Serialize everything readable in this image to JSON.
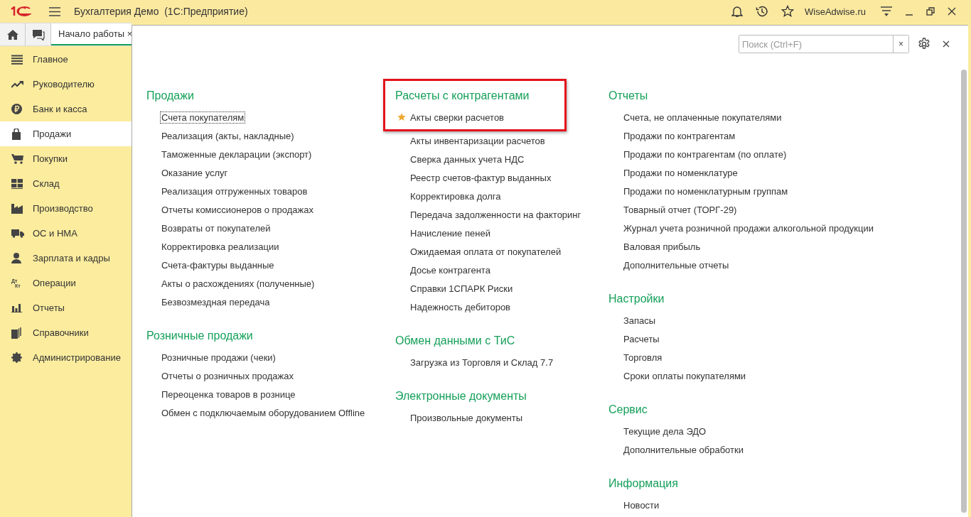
{
  "app": {
    "title": "Бухгалтерия Демо  (1С:Предприятие)",
    "user": "WiseAdwise.ru"
  },
  "tabs": [
    {
      "label": "Начало работы",
      "close": "×",
      "selected": true
    }
  ],
  "sidebar": {
    "items": [
      {
        "label": "Главное",
        "kind": "list",
        "selected": false
      },
      {
        "label": "Руководителю",
        "kind": "trend",
        "selected": false
      },
      {
        "label": "Банк и касса",
        "kind": "ruble",
        "selected": false
      },
      {
        "label": "Продажи",
        "kind": "bag",
        "selected": true
      },
      {
        "label": "Покупки",
        "kind": "cart",
        "selected": false
      },
      {
        "label": "Склад",
        "kind": "grid",
        "selected": false
      },
      {
        "label": "Производство",
        "kind": "factory",
        "selected": false
      },
      {
        "label": "ОС и НМА",
        "kind": "truck",
        "selected": false
      },
      {
        "label": "Зарплата и кадры",
        "kind": "person",
        "selected": false
      },
      {
        "label": "Операции",
        "kind": "dtkt",
        "selected": false
      },
      {
        "label": "Отчеты",
        "kind": "bars",
        "selected": false
      },
      {
        "label": "Справочники",
        "kind": "books",
        "selected": false
      },
      {
        "label": "Администрирование",
        "kind": "gear",
        "selected": false
      }
    ]
  },
  "dtkt_icon": {
    "top": "Дт",
    "bottom": "Кт"
  },
  "search": {
    "placeholder": "Поиск (Ctrl+F)",
    "clear": "×"
  },
  "columns": [
    [
      {
        "title": "Продажи",
        "highlighted": false,
        "items": [
          {
            "label": "Счета покупателям",
            "favorite": false,
            "focused": true
          },
          {
            "label": "Реализация (акты, накладные)",
            "favorite": false,
            "focused": false
          },
          {
            "label": "Таможенные декларации (экспорт)",
            "favorite": false,
            "focused": false
          },
          {
            "label": "Оказание услуг",
            "favorite": false,
            "focused": false
          },
          {
            "label": "Реализация отгруженных товаров",
            "favorite": false,
            "focused": false
          },
          {
            "label": "Отчеты комиссионеров о продажах",
            "favorite": false,
            "focused": false
          },
          {
            "label": "Возвраты от покупателей",
            "favorite": false,
            "focused": false
          },
          {
            "label": "Корректировка реализации",
            "favorite": false,
            "focused": false
          },
          {
            "label": "Счета-фактуры выданные",
            "favorite": false,
            "focused": false
          },
          {
            "label": "Акты о расхождениях (полученные)",
            "favorite": false,
            "focused": false
          },
          {
            "label": "Безвозмездная передача",
            "favorite": false,
            "focused": false
          }
        ]
      },
      {
        "title": "Розничные продажи",
        "highlighted": false,
        "items": [
          {
            "label": "Розничные продажи (чеки)",
            "favorite": false,
            "focused": false
          },
          {
            "label": "Отчеты о розничных продажах",
            "favorite": false,
            "focused": false
          },
          {
            "label": "Переоценка товаров в рознице",
            "favorite": false,
            "focused": false
          },
          {
            "label": "Обмен с подключаемым оборудованием Offline",
            "favorite": false,
            "focused": false
          }
        ]
      }
    ],
    [
      {
        "title": "Расчеты с контрагентами",
        "highlighted": true,
        "items": [
          {
            "label": "Акты сверки расчетов",
            "favorite": true,
            "focused": false
          },
          {
            "label": "Акты инвентаризации расчетов",
            "favorite": false,
            "focused": false
          },
          {
            "label": "Сверка данных учета НДС",
            "favorite": false,
            "focused": false
          },
          {
            "label": "Реестр счетов-фактур выданных",
            "favorite": false,
            "focused": false
          },
          {
            "label": "Корректировка долга",
            "favorite": false,
            "focused": false
          },
          {
            "label": "Передача задолженности на факторинг",
            "favorite": false,
            "focused": false
          },
          {
            "label": "Начисление пеней",
            "favorite": false,
            "focused": false
          },
          {
            "label": "Ожидаемая оплата от покупателей",
            "favorite": false,
            "focused": false
          },
          {
            "label": "Досье контрагента",
            "favorite": false,
            "focused": false
          },
          {
            "label": "Справки 1СПАРК Риски",
            "favorite": false,
            "focused": false
          },
          {
            "label": "Надежность дебиторов",
            "favorite": false,
            "focused": false
          }
        ]
      },
      {
        "title": "Обмен данными с ТиС",
        "highlighted": false,
        "items": [
          {
            "label": "Загрузка из Торговля и Склад 7.7",
            "favorite": false,
            "focused": false
          }
        ]
      },
      {
        "title": "Электронные документы",
        "highlighted": false,
        "items": [
          {
            "label": "Произвольные документы",
            "favorite": false,
            "focused": false
          }
        ]
      }
    ],
    [
      {
        "title": "Отчеты",
        "highlighted": false,
        "items": [
          {
            "label": "Счета, не оплаченные покупателями",
            "favorite": false,
            "focused": false
          },
          {
            "label": "Продажи по контрагентам",
            "favorite": false,
            "focused": false
          },
          {
            "label": "Продажи по контрагентам (по оплате)",
            "favorite": false,
            "focused": false
          },
          {
            "label": "Продажи по номенклатуре",
            "favorite": false,
            "focused": false
          },
          {
            "label": "Продажи по номенклатурным группам",
            "favorite": false,
            "focused": false
          },
          {
            "label": "Товарный отчет (ТОРГ-29)",
            "favorite": false,
            "focused": false
          },
          {
            "label": "Журнал учета розничной продажи алкогольной продукции",
            "favorite": false,
            "focused": false
          },
          {
            "label": "Валовая прибыль",
            "favorite": false,
            "focused": false
          },
          {
            "label": "Дополнительные отчеты",
            "favorite": false,
            "focused": false
          }
        ]
      },
      {
        "title": "Настройки",
        "highlighted": false,
        "items": [
          {
            "label": "Запасы",
            "favorite": false,
            "focused": false
          },
          {
            "label": "Расчеты",
            "favorite": false,
            "focused": false
          },
          {
            "label": "Торговля",
            "favorite": false,
            "focused": false
          },
          {
            "label": "Сроки оплаты покупателями",
            "favorite": false,
            "focused": false
          }
        ]
      },
      {
        "title": "Сервис",
        "highlighted": false,
        "items": [
          {
            "label": "Текущие дела ЭДО",
            "favorite": false,
            "focused": false
          },
          {
            "label": "Дополнительные обработки",
            "favorite": false,
            "focused": false
          }
        ]
      },
      {
        "title": "Информация",
        "highlighted": false,
        "items": [
          {
            "label": "Новости",
            "favorite": false,
            "focused": false
          }
        ]
      }
    ]
  ]
}
